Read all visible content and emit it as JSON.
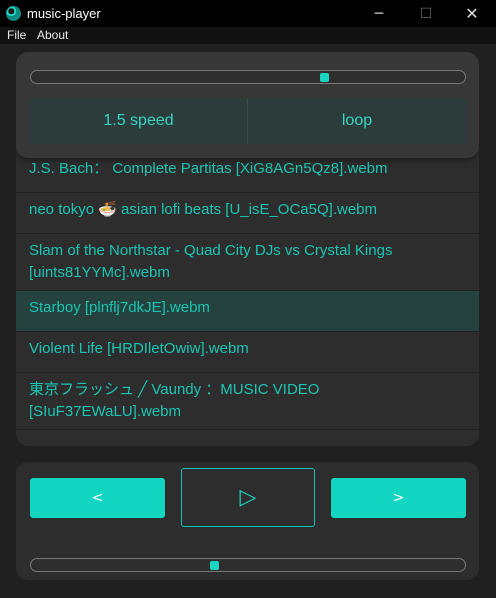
{
  "window": {
    "title": "music-player",
    "minimize_glyph": "─",
    "maximize_glyph": "☐",
    "close_glyph": "✕"
  },
  "menu": {
    "items": [
      {
        "label": "File"
      },
      {
        "label": "About"
      }
    ]
  },
  "player": {
    "seek_progress": 0.68,
    "speed_label": "1.5 speed",
    "loop_label": "loop",
    "volume_level": 0.42,
    "prev_label": "<",
    "play_glyph": "▷",
    "next_label": ">"
  },
  "playlist": {
    "selected_index": 3,
    "songs": [
      {
        "title": "J.S. Bach： Complete Partitas [XiG8AGn5Qz8].webm"
      },
      {
        "title": "neo tokyo 🍜 asian lofi beats [U_isE_OCa5Q].webm"
      },
      {
        "title": "Slam of the Northstar - Quad City DJs vs Crystal Kings [uints81YYMc].webm"
      },
      {
        "title": "Starboy [plnflj7dkJE].webm"
      },
      {
        "title": "Violent Life [HRDIletOwiw].webm"
      },
      {
        "title": "東京フラッシュ ╱ Vaundy ：MUSIC VIDEO [SIuF37EWaLU].webm"
      }
    ]
  },
  "colors": {
    "accent": "#12d6c2",
    "text_accent": "#18c6b4",
    "selected_row": "#25423f",
    "panel": "#2d2d2d",
    "background": "#202020"
  }
}
